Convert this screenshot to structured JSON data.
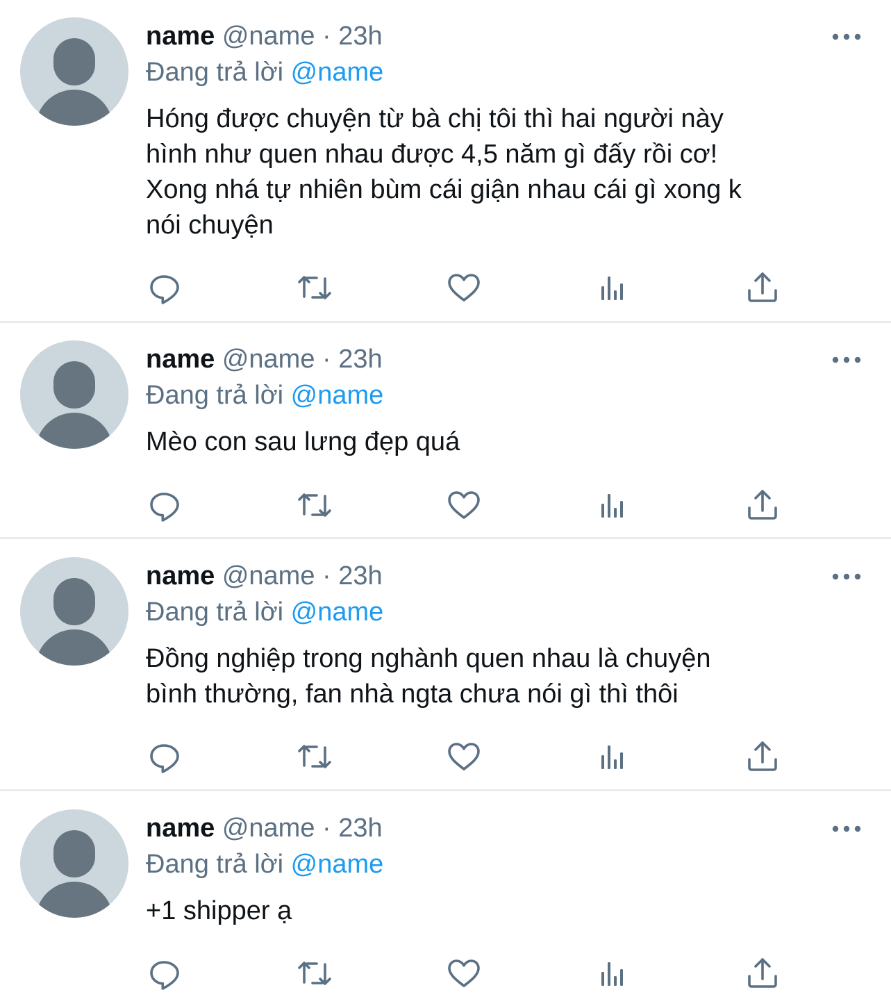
{
  "colors": {
    "text_primary": "#0f1419",
    "text_secondary": "#5b7083",
    "accent": "#1d9bf0",
    "avatar_bg": "#ccd6dd",
    "avatar_fg": "#66757f",
    "divider": "#e6ecf0"
  },
  "tweets": [
    {
      "name": "name",
      "handle": "@name",
      "separator": "·",
      "time": "23h",
      "reply_prefix": "Đang trả lời",
      "reply_to": "@name",
      "text_lines": [
        "Hóng được chuyện từ bà chị tôi thì hai người này",
        "hình như quen nhau được 4,5 năm gì đấy rồi cơ!",
        "Xong nhá tự nhiên bùm cái giận nhau cái gì xong k",
        "nói chuyện"
      ]
    },
    {
      "name": "name",
      "handle": "@name",
      "separator": "·",
      "time": "23h",
      "reply_prefix": "Đang trả lời",
      "reply_to": "@name",
      "text_lines": [
        "Mèo con sau lưng đẹp quá"
      ]
    },
    {
      "name": "name",
      "handle": "@name",
      "separator": "·",
      "time": "23h",
      "reply_prefix": "Đang trả lời",
      "reply_to": "@name",
      "text_lines": [
        "Đồng nghiệp trong nghành quen nhau là chuyện",
        "bình thường, fan nhà ngta chưa nói gì thì thôi"
      ]
    },
    {
      "name": "name",
      "handle": "@name",
      "separator": "·",
      "time": "23h",
      "reply_prefix": "Đang trả lời",
      "reply_to": "@name",
      "text_lines": [
        "+1 shipper ạ"
      ]
    }
  ],
  "action_icons": [
    "reply-icon",
    "retweet-icon",
    "like-icon",
    "analytics-icon",
    "share-icon"
  ],
  "more_icon": "more-icon"
}
